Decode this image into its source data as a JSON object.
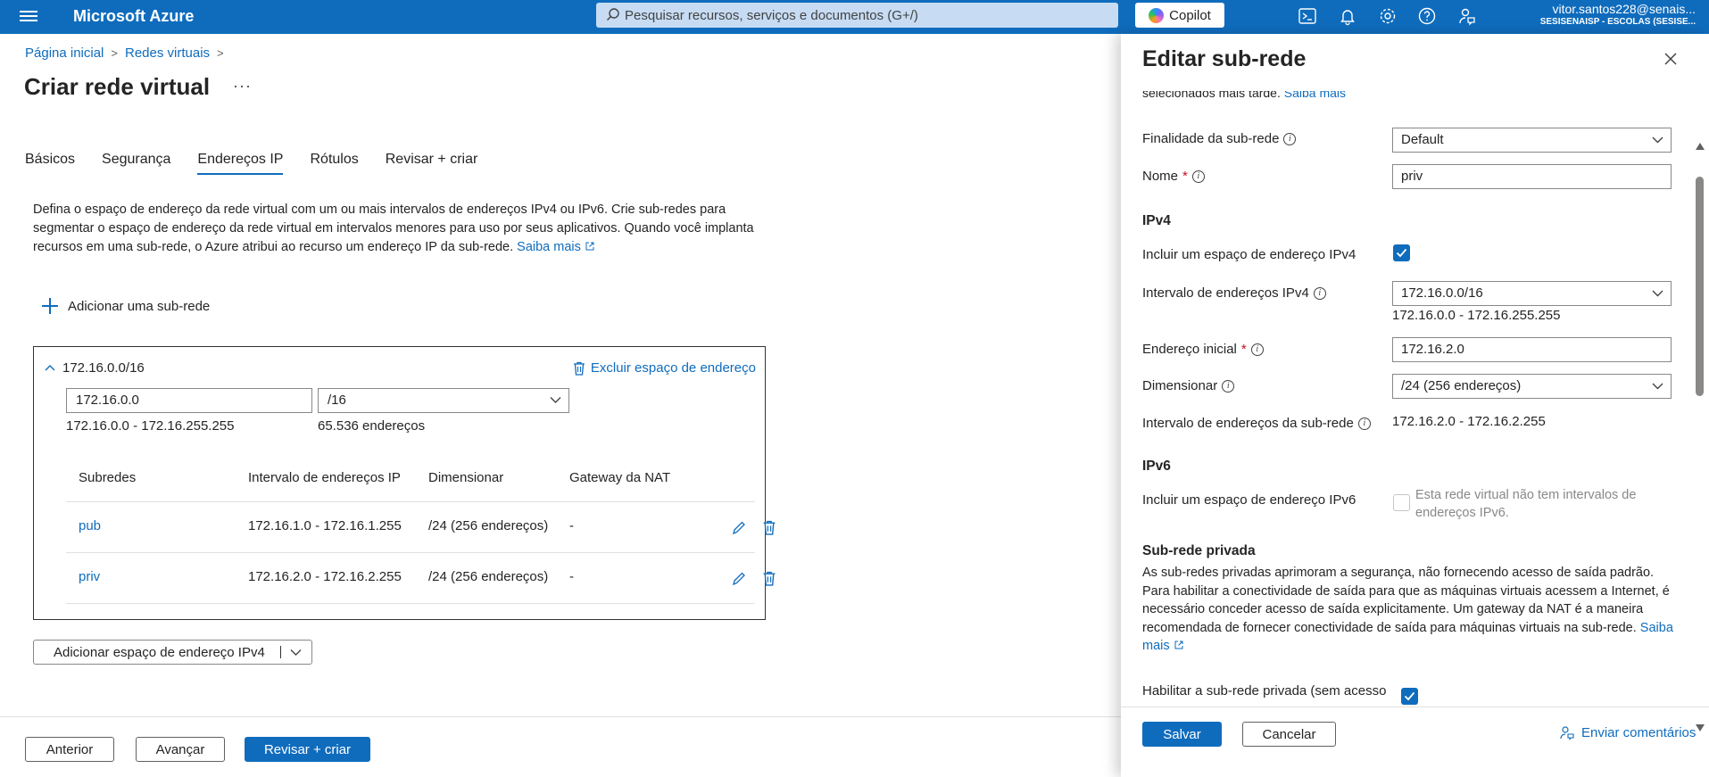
{
  "topbar": {
    "brand": "Microsoft Azure",
    "search_placeholder": "Pesquisar recursos, serviços e documentos (G+/)",
    "copilot_label": "Copilot",
    "account_name": "vitor.santos228@senais...",
    "account_tenant": "SESISENAISP - ESCOLAS (SESISE..."
  },
  "breadcrumb": {
    "home": "Página inicial",
    "vnets": "Redes virtuais",
    "separator": ">"
  },
  "page": {
    "title": "Criar rede virtual",
    "more": "···"
  },
  "tabs": [
    {
      "label": "Básicos",
      "active": false
    },
    {
      "label": "Segurança",
      "active": false
    },
    {
      "label": "Endereços IP",
      "active": true
    },
    {
      "label": "Rótulos",
      "active": false
    },
    {
      "label": "Revisar + criar",
      "active": false
    }
  ],
  "description": {
    "text": "Defina o espaço de endereço da rede virtual com um ou mais intervalos de endereços IPv4 ou IPv6. Crie sub-redes para segmentar o espaço de endereço da rede virtual em intervalos menores para uso por seus aplicativos. Quando você implanta recursos em uma sub-rede, o Azure atribui ao recurso um endereço IP da sub-rede.",
    "learn_more": "Saiba mais"
  },
  "add_subnet_label": "Adicionar uma sub-rede",
  "address_space": {
    "title": "172.16.0.0/16",
    "delete_label": "Excluir espaço de endereço",
    "address_value": "172.16.0.0",
    "prefix_value": "/16",
    "range": "172.16.0.0 - 172.16.255.255",
    "count": "65.536 endereços",
    "columns": [
      "Subredes",
      "Intervalo de endereços IP",
      "Dimensionar",
      "Gateway da NAT"
    ],
    "subnets": [
      {
        "name": "pub",
        "range": "172.16.1.0 - 172.16.1.255",
        "size": "/24 (256 endereços)",
        "nat": "-"
      },
      {
        "name": "priv",
        "range": "172.16.2.0 - 172.16.2.255",
        "size": "/24 (256 endereços)",
        "nat": "-"
      }
    ]
  },
  "add_ipv4_label": "Adicionar espaço de endereço IPv4",
  "footer": {
    "prev": "Anterior",
    "next": "Avançar",
    "review": "Revisar + criar"
  },
  "panel": {
    "title": "Editar sub-rede",
    "cutoff_text": "selecionados mais tarde.",
    "cutoff_link": "Saiba mais",
    "purpose_label": "Finalidade da sub-rede",
    "purpose_value": "Default",
    "name_label": "Nome",
    "name_value": "priv",
    "required_mark": "*",
    "ipv4_section": "IPv4",
    "include_ipv4_label": "Incluir um espaço de endereço IPv4",
    "include_ipv4_checked": true,
    "ipv4_range_label": "Intervalo de endereços IPv4",
    "ipv4_range_value": "172.16.0.0/16",
    "ipv4_range_span": "172.16.0.0 - 172.16.255.255",
    "start_label": "Endereço inicial",
    "start_value": "172.16.2.0",
    "size_label": "Dimensionar",
    "size_value": "/24 (256 endereços)",
    "subnet_range_label": "Intervalo de endereços da sub-rede",
    "subnet_range_value": "172.16.2.0 - 172.16.2.255",
    "ipv6_section": "IPv6",
    "include_ipv6_label": "Incluir um espaço de endereço IPv6",
    "include_ipv6_checked": false,
    "ipv6_disabled_text": "Esta rede virtual não tem intervalos de endereços IPv6.",
    "private_section": "Sub-rede privada",
    "private_desc": "As sub-redes privadas aprimoram a segurança, não fornecendo acesso de saída padrão. Para habilitar a conectividade de saída para que as máquinas virtuais acessem a Internet, é necessário conceder acesso de saída explicitamente. Um gateway da NAT é a maneira recomendada de fornecer conectividade de saída para máquinas virtuais na sub-rede.",
    "private_learn_more": "Saiba mais",
    "enable_private_label": "Habilitar a sub-rede privada (sem acesso",
    "enable_private_checked": true,
    "save": "Salvar",
    "cancel": "Cancelar",
    "feedback": "Enviar comentários"
  },
  "colors": {
    "accent": "#0f6cbd",
    "topbar": "#0f6cbd",
    "required": "#c50f1f"
  },
  "icons": [
    "hamburger-icon",
    "search-icon",
    "copilot-icon",
    "cloud-shell-icon",
    "bell-icon",
    "gear-icon",
    "help-icon",
    "feedback-icon",
    "chevron-up-icon",
    "trash-icon",
    "edit-icon",
    "plus-icon",
    "close-icon",
    "info-icon",
    "chevron-down-icon",
    "external-link-icon"
  ]
}
